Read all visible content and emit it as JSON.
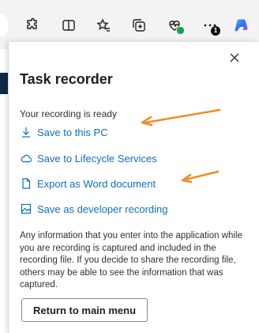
{
  "panel": {
    "title": "Task recorder",
    "status": "Your recording is ready",
    "actions": [
      {
        "label": "Save to this PC",
        "icon": "download-icon"
      },
      {
        "label": "Save to Lifecycle Services",
        "icon": "cloud-icon"
      },
      {
        "label": "Export as Word document",
        "icon": "document-icon"
      },
      {
        "label": "Save as developer recording",
        "icon": "image-icon"
      }
    ],
    "info_text": "Any information that you enter into the application while you are recording is captured and included in the recording file. If you decide to share the recording file, others may be able to see the information that was captured.",
    "main_button": "Return to main menu"
  },
  "toolbar": {
    "icons": [
      "extensions-icon",
      "split-screen-icon",
      "favorites-icon",
      "collections-icon",
      "browser-essentials-icon",
      "more-icon",
      "copilot-icon"
    ],
    "notification_count": "1"
  },
  "colors": {
    "link": "#106ebe",
    "arrow": "#f08a24",
    "page_header": "#0e2a47"
  }
}
